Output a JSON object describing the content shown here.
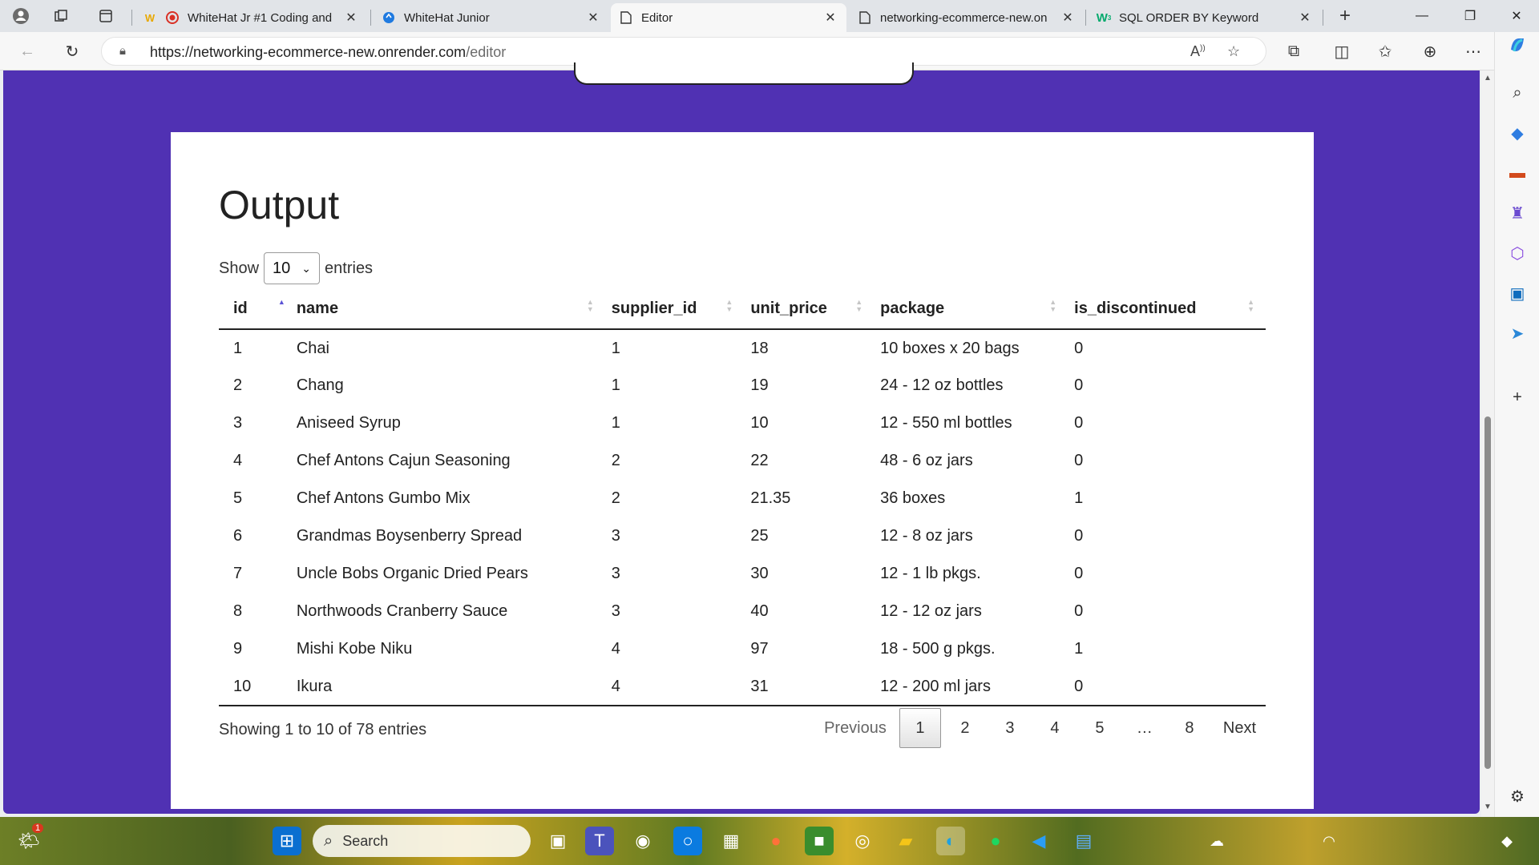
{
  "browser": {
    "tabs": [
      {
        "label": "WhiteHat Jr #1 Coding and",
        "icon": "whitehat-w-icon"
      },
      {
        "label": "WhiteHat Junior",
        "icon": "whitehat-logo-icon"
      },
      {
        "label": "Editor",
        "icon": "page-icon"
      },
      {
        "label": "networking-ecommerce-new.on",
        "icon": "page-icon"
      },
      {
        "label": "SQL ORDER BY Keyword",
        "icon": "w3schools-icon"
      }
    ],
    "url_host": "https://networking-ecommerce-new.onrender.com",
    "url_path": "/editor"
  },
  "output": {
    "title": "Output",
    "show_label": "Show",
    "entries_label": "entries",
    "page_length": "10",
    "columns": [
      "id",
      "name",
      "supplier_id",
      "unit_price",
      "package",
      "is_discontinued"
    ],
    "rows": [
      [
        "1",
        "Chai",
        "1",
        "18",
        "10 boxes x 20 bags",
        "0"
      ],
      [
        "2",
        "Chang",
        "1",
        "19",
        "24 - 12 oz bottles",
        "0"
      ],
      [
        "3",
        "Aniseed Syrup",
        "1",
        "10",
        "12 - 550 ml bottles",
        "0"
      ],
      [
        "4",
        "Chef Antons Cajun Seasoning",
        "2",
        "22",
        "48 - 6 oz jars",
        "0"
      ],
      [
        "5",
        "Chef Antons Gumbo Mix",
        "2",
        "21.35",
        "36 boxes",
        "1"
      ],
      [
        "6",
        "Grandmas Boysenberry Spread",
        "3",
        "25",
        "12 - 8 oz jars",
        "0"
      ],
      [
        "7",
        "Uncle Bobs Organic Dried Pears",
        "3",
        "30",
        "12 - 1 lb pkgs.",
        "0"
      ],
      [
        "8",
        "Northwoods Cranberry Sauce",
        "3",
        "40",
        "12 - 12 oz jars",
        "0"
      ],
      [
        "9",
        "Mishi Kobe Niku",
        "4",
        "97",
        "18 - 500 g pkgs.",
        "1"
      ],
      [
        "10",
        "Ikura",
        "4",
        "31",
        "12 - 200 ml jars",
        "0"
      ]
    ],
    "info": "Showing 1 to 10 of 78 entries",
    "pagination": {
      "previous": "Previous",
      "pages": [
        "1",
        "2",
        "3",
        "4",
        "5",
        "…",
        "8"
      ],
      "current": "1",
      "next": "Next"
    }
  },
  "taskbar": {
    "search_placeholder": "Search",
    "weather_badge": "1"
  },
  "colors": {
    "page_background": "#5031b3",
    "sort_active": "#5b53d6"
  }
}
